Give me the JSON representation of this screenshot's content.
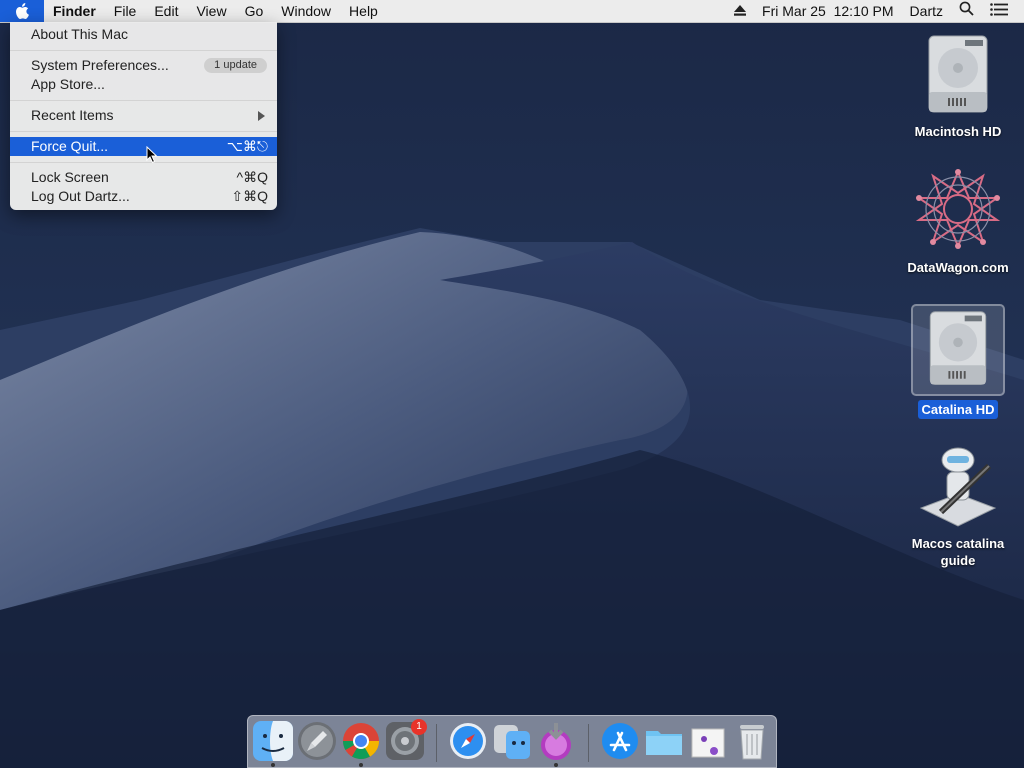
{
  "menubar": {
    "apple_icon": "apple-logo-icon",
    "app_name": "Finder",
    "menus": [
      "File",
      "Edit",
      "View",
      "Go",
      "Window",
      "Help"
    ],
    "status": {
      "eject_icon": "eject-icon",
      "datetime": "Fri Mar 25  12:10 PM",
      "user": "Dartz",
      "search_icon": "spotlight-search-icon",
      "list_icon": "notification-center-icon"
    }
  },
  "apple_menu": {
    "about": "About This Mac",
    "system_prefs": "System Preferences...",
    "system_prefs_badge": "1 update",
    "app_store": "App Store...",
    "recent_items": "Recent Items",
    "force_quit": "Force Quit...",
    "force_quit_shortcut": "⌥⌘⎋",
    "lock_screen": "Lock Screen",
    "lock_screen_shortcut": "^⌘Q",
    "log_out": "Log Out Dartz...",
    "log_out_shortcut": "⇧⌘Q",
    "highlight_color": "#1a5fd8"
  },
  "desktop_icons": [
    {
      "label": "Macintosh HD",
      "icon": "hard-drive-icon",
      "selected": false
    },
    {
      "label": "DataWagon.com",
      "icon": "network-share-icon",
      "selected": false
    },
    {
      "label": "Catalina HD",
      "icon": "hard-drive-icon",
      "selected": true
    },
    {
      "label": "Macos catalina guide",
      "icon": "automator-icon",
      "selected": false
    }
  ],
  "dock": {
    "apps": [
      {
        "name": "Finder",
        "icon": "finder-icon",
        "running": true
      },
      {
        "name": "Launchpad",
        "icon": "launchpad-icon",
        "running": false
      },
      {
        "name": "Google Chrome",
        "icon": "chrome-icon",
        "running": true
      },
      {
        "name": "System Preferences",
        "icon": "system-preferences-icon",
        "running": false,
        "badge": "1"
      },
      {
        "name": "Safari",
        "icon": "safari-icon",
        "running": false
      },
      {
        "name": "Migration Assistant",
        "icon": "migration-assistant-icon",
        "running": false
      },
      {
        "name": "macOS Installer",
        "icon": "macos-installer-icon",
        "running": true
      },
      {
        "name": "App Store",
        "icon": "app-store-icon",
        "running": false
      },
      {
        "name": "Folder",
        "icon": "folder-icon",
        "running": false
      },
      {
        "name": "Document Stack",
        "icon": "stack-icon",
        "running": false
      },
      {
        "name": "Trash",
        "icon": "trash-icon",
        "running": false
      }
    ]
  }
}
